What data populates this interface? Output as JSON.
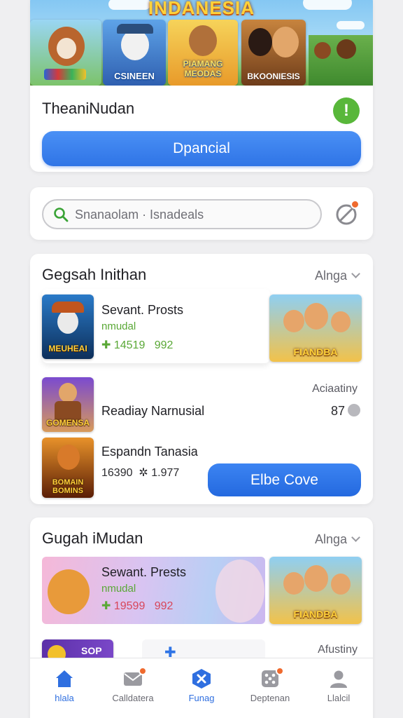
{
  "hero": {
    "banner_title": "INDANESIA",
    "tiles": [
      "",
      "CSINEEN",
      "PIAMANG MEODAS",
      "BKOONIESIS"
    ],
    "title": "TheaniNudan",
    "primary_button": "Dpancial"
  },
  "search": {
    "placeholder": "Snanaolam · Isnadeals"
  },
  "section1": {
    "title": "Gegsah Inithan",
    "link": "Alnga",
    "item1": {
      "thumb_label": "MEUHEAI",
      "title": "Sevant. Prosts",
      "subtitle": "nmudal",
      "stat": "14519",
      "stat2": "992",
      "side_label": "FIANDBA"
    },
    "item2": {
      "thumb_label": "GOMENSA",
      "title": "Readiay Narnusial",
      "meta": "Aciaatiny",
      "count": "87"
    },
    "item3": {
      "thumb_label": "BOMAIN BOMINS",
      "title": "Espandn Tanasia",
      "stat_a": "16390",
      "stat_b": "1.977",
      "button": "Elbe Cove"
    }
  },
  "section2": {
    "title": "Gugah iMudan",
    "link": "Alnga",
    "featured": {
      "title": "Sewant. Prests",
      "subtitle": "nmudal",
      "stat": "19599",
      "stat2": "992",
      "side_label": "FIANDBA"
    },
    "partial": {
      "thumb_label": "SOP",
      "meta": "Afustiny"
    }
  },
  "nav": {
    "items": [
      {
        "label": "hlala",
        "icon": "home-icon"
      },
      {
        "label": "Calldatera",
        "icon": "mail-icon"
      },
      {
        "label": "Funag",
        "icon": "games-icon"
      },
      {
        "label": "Deptenan",
        "icon": "dice-icon"
      },
      {
        "label": "Llalcil",
        "icon": "profile-icon"
      }
    ]
  },
  "colors": {
    "accent": "#2f74e6",
    "success": "#58b73a",
    "notify": "#ef6a2e"
  }
}
